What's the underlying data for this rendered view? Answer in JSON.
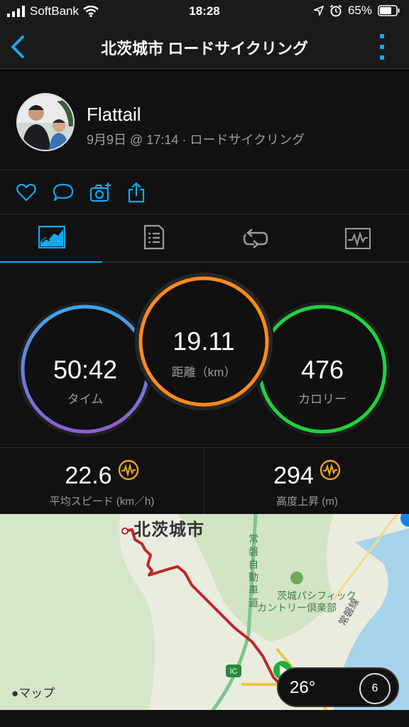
{
  "status": {
    "carrier": "SoftBank",
    "time": "18:28",
    "battery": "65%"
  },
  "nav": {
    "title": "北茨城市 ロードサイクリング"
  },
  "profile": {
    "name": "Flattail",
    "meta": "9月9日 @ 17:14 · ロードサイクリング"
  },
  "tabs": [
    {
      "label": "overview-tab",
      "active": true
    },
    {
      "label": "details-tab",
      "active": false
    },
    {
      "label": "laps-tab",
      "active": false
    },
    {
      "label": "charts-tab",
      "active": false
    }
  ],
  "rings": {
    "time": {
      "value": "50:42",
      "label": "タイム",
      "color_start": "#3fa6ea",
      "color_end": "#8d5fcf"
    },
    "distance": {
      "value": "19.11",
      "label": "距離（km）",
      "color": "#ff8a1c"
    },
    "calories": {
      "value": "476",
      "label": "カロリー",
      "color": "#1fd23c"
    }
  },
  "metrics": [
    {
      "value": "22.6",
      "label": "平均スピード (km／h)"
    },
    {
      "value": "294",
      "label": "高度上昇 (m)"
    }
  ],
  "map": {
    "city": "北茨城市",
    "attribution": "マップ",
    "temperature": "26°",
    "wind": "6"
  },
  "colors": {
    "accent": "#11a9ed",
    "route": "#c4252b",
    "badge": "#f2a31b"
  }
}
